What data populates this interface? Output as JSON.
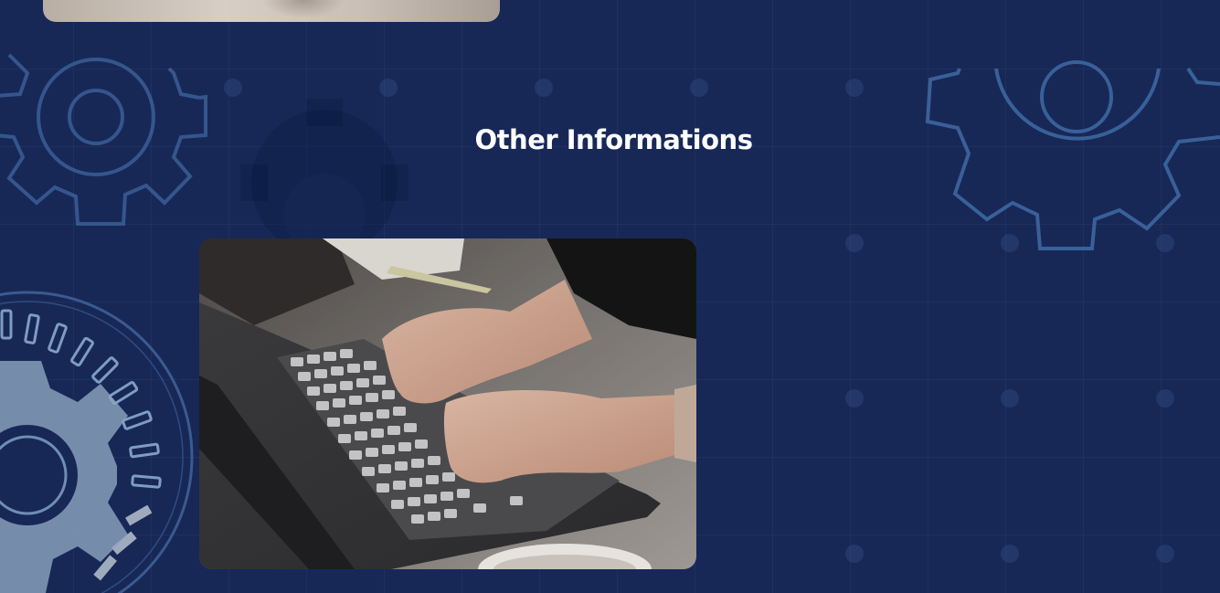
{
  "section": {
    "title": "Other Informations"
  },
  "images": {
    "top_image": "portrait-photo",
    "info_image": "laptop-typing-photo"
  },
  "icons": {
    "decor_left": "gear-icon",
    "decor_right": "gear-icon",
    "decor_dial": "dial-gear-icon"
  },
  "colors": {
    "background": "#172857",
    "heading": "#ffffff",
    "gear_outline": "#3f6aa0"
  }
}
